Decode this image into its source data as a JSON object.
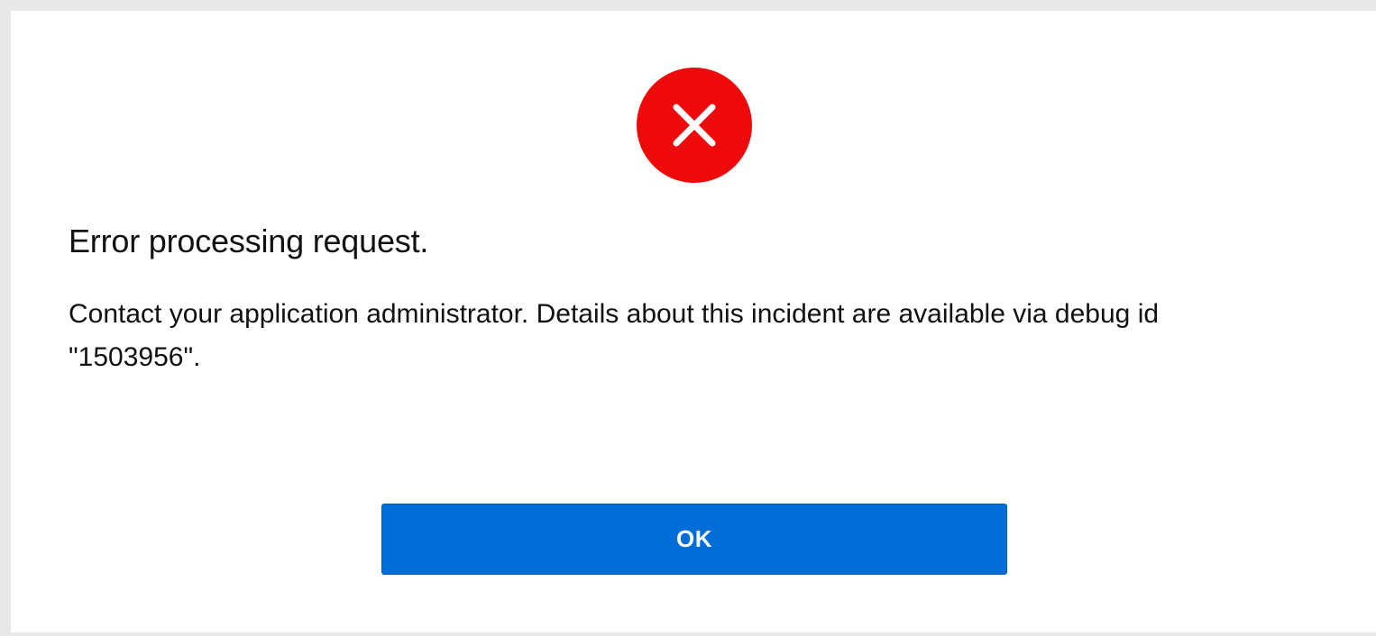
{
  "dialog": {
    "icon": "error-x-icon",
    "icon_color": "#ee0a0a",
    "title": "Error processing request.",
    "message": "Contact your application administrator. Details about this incident are available via debug id \"1503956\".",
    "ok_label": "OK",
    "button_color": "#006dd8"
  }
}
